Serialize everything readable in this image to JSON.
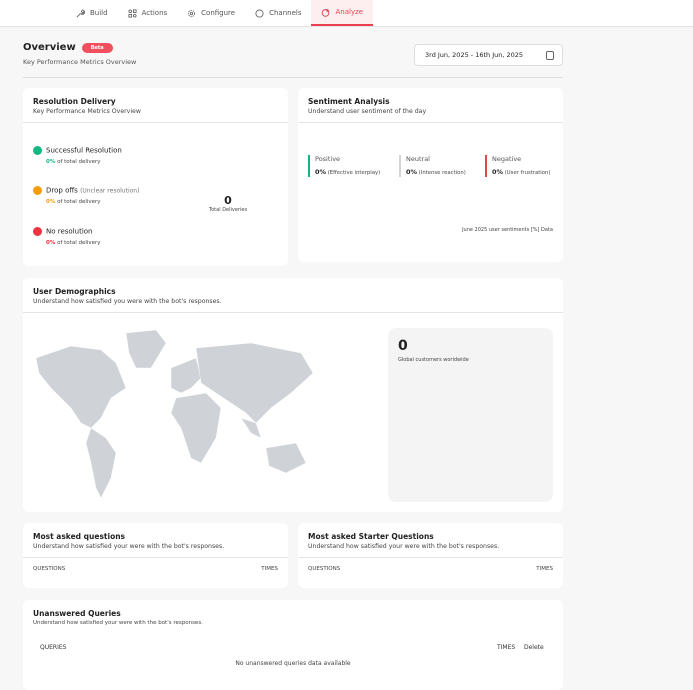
{
  "nav": {
    "tabs": [
      {
        "label": "Build",
        "icon": "wrench-icon"
      },
      {
        "label": "Actions",
        "icon": "actions-icon"
      },
      {
        "label": "Configure",
        "icon": "gear-icon"
      },
      {
        "label": "Channels",
        "icon": "chat-icon"
      },
      {
        "label": "Analyze",
        "icon": "pie-chart-icon",
        "active": true
      }
    ]
  },
  "header": {
    "title": "Overview",
    "badge": "Beta",
    "subtitle": "Key Performance Metrics Overview",
    "date_range": "3rd Jun, 2025 - 16th Jun, 2025"
  },
  "resolution": {
    "title": "Resolution Delivery",
    "subtitle": "Key Performance Metrics Overview",
    "items": [
      {
        "label": "Successful Resolution",
        "note": "",
        "pct": "0%",
        "suffix": "of total delivery",
        "color": "#10b981"
      },
      {
        "label": "Drop offs",
        "note": "(Unclear resolution)",
        "pct": "0%",
        "suffix": "of total delivery",
        "color": "#f59e0b"
      },
      {
        "label": "No resolution",
        "note": "",
        "pct": "0%",
        "suffix": "of total delivery",
        "color": "#ef3340"
      }
    ],
    "total": "0",
    "total_label": "Total Deliveries"
  },
  "sentiment": {
    "title": "Sentiment Analysis",
    "subtitle": "Understand user sentiment of the day",
    "items": [
      {
        "label": "Positive",
        "pct": "0%",
        "note": "(Effective interplay)",
        "color": "#10b981"
      },
      {
        "label": "Neutral",
        "pct": "0%",
        "note": "(Intense reaction)",
        "color": "#d4d4d4"
      },
      {
        "label": "Negative",
        "pct": "0%",
        "note": "(User frustration)",
        "color": "#e04848"
      }
    ],
    "footer": "June 2025 user sentiments [%] Data"
  },
  "demographics": {
    "title": "User Demographics",
    "subtitle": "Understand how satisfied you were with the bot's responses.",
    "count": "0",
    "count_label": "Global customers worldwide"
  },
  "most_asked": {
    "title": "Most asked questions",
    "subtitle": "Understand how satisfied your were with the bot's responses.",
    "col1": "QUESTIONS",
    "col2": "TIMES"
  },
  "starter": {
    "title": "Most asked Starter Questions",
    "subtitle": "Understand how satisfied your were with the bot's responses.",
    "col1": "QUESTIONS",
    "col2": "TIMES"
  },
  "unanswered": {
    "title": "Unanswered Queries",
    "subtitle": "Understand how satisfied your were with the bot's responses.",
    "col1": "QUERIES",
    "col2": "TIMES",
    "col3": "Delete",
    "empty": "No unanswered queries data available"
  }
}
